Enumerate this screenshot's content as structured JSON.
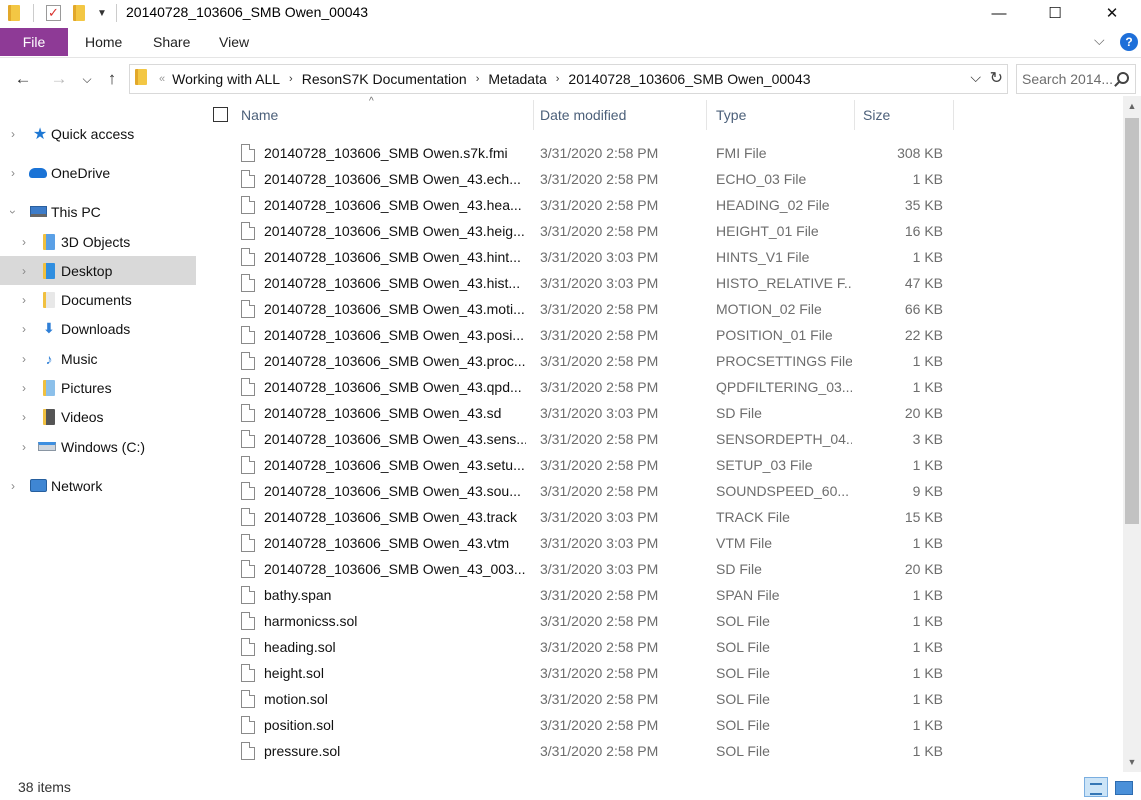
{
  "window": {
    "title": "20140728_103606_SMB Owen_00043",
    "controls": {
      "minimize": "—",
      "maximize": "☐",
      "close": "✕"
    }
  },
  "ribbon": {
    "file_tab": "File",
    "tabs": [
      "Home",
      "Share",
      "View"
    ],
    "accent": "#8e3a96",
    "help": "?"
  },
  "address": {
    "breadcrumbs": [
      "Working with ALL",
      "ResonS7K Documentation",
      "Metadata",
      "20140728_103606_SMB Owen_00043"
    ],
    "overflow": "«",
    "search_placeholder": "Search 2014..."
  },
  "navigation": {
    "items": [
      {
        "label": "Quick access",
        "icon": "star-icon"
      },
      {
        "label": "OneDrive",
        "icon": "cloud-icon"
      },
      {
        "label": "This PC",
        "icon": "computer-icon"
      },
      {
        "label": "3D Objects",
        "icon": "cube-folder-icon"
      },
      {
        "label": "Desktop",
        "icon": "desktop-folder-icon"
      },
      {
        "label": "Documents",
        "icon": "documents-folder-icon"
      },
      {
        "label": "Downloads",
        "icon": "downloads-folder-icon"
      },
      {
        "label": "Music",
        "icon": "music-folder-icon"
      },
      {
        "label": "Pictures",
        "icon": "pictures-folder-icon"
      },
      {
        "label": "Videos",
        "icon": "videos-folder-icon"
      },
      {
        "label": "Windows (C:)",
        "icon": "drive-icon"
      },
      {
        "label": "Network",
        "icon": "network-icon"
      }
    ]
  },
  "columns": {
    "name": "Name",
    "date": "Date modified",
    "type": "Type",
    "size": "Size"
  },
  "files": [
    {
      "name": "20140728_103606_SMB Owen.s7k.fmi",
      "date": "3/31/2020 2:58 PM",
      "type": "FMI File",
      "size": "308 KB"
    },
    {
      "name": "20140728_103606_SMB Owen_43.ech...",
      "date": "3/31/2020 2:58 PM",
      "type": "ECHO_03 File",
      "size": "1 KB"
    },
    {
      "name": "20140728_103606_SMB Owen_43.hea...",
      "date": "3/31/2020 2:58 PM",
      "type": "HEADING_02 File",
      "size": "35 KB"
    },
    {
      "name": "20140728_103606_SMB Owen_43.heig...",
      "date": "3/31/2020 2:58 PM",
      "type": "HEIGHT_01 File",
      "size": "16 KB"
    },
    {
      "name": "20140728_103606_SMB Owen_43.hint...",
      "date": "3/31/2020 3:03 PM",
      "type": "HINTS_V1 File",
      "size": "1 KB"
    },
    {
      "name": "20140728_103606_SMB Owen_43.hist...",
      "date": "3/31/2020 3:03 PM",
      "type": "HISTO_RELATIVE F...",
      "size": "47 KB"
    },
    {
      "name": "20140728_103606_SMB Owen_43.moti...",
      "date": "3/31/2020 2:58 PM",
      "type": "MOTION_02 File",
      "size": "66 KB"
    },
    {
      "name": "20140728_103606_SMB Owen_43.posi...",
      "date": "3/31/2020 2:58 PM",
      "type": "POSITION_01 File",
      "size": "22 KB"
    },
    {
      "name": "20140728_103606_SMB Owen_43.proc...",
      "date": "3/31/2020 2:58 PM",
      "type": "PROCSETTINGS File",
      "size": "1 KB"
    },
    {
      "name": "20140728_103606_SMB Owen_43.qpd...",
      "date": "3/31/2020 2:58 PM",
      "type": "QPDFILTERING_03...",
      "size": "1 KB"
    },
    {
      "name": "20140728_103606_SMB Owen_43.sd",
      "date": "3/31/2020 3:03 PM",
      "type": "SD File",
      "size": "20 KB"
    },
    {
      "name": "20140728_103606_SMB Owen_43.sens...",
      "date": "3/31/2020 2:58 PM",
      "type": "SENSORDEPTH_04...",
      "size": "3 KB"
    },
    {
      "name": "20140728_103606_SMB Owen_43.setu...",
      "date": "3/31/2020 2:58 PM",
      "type": "SETUP_03 File",
      "size": "1 KB"
    },
    {
      "name": "20140728_103606_SMB Owen_43.sou...",
      "date": "3/31/2020 2:58 PM",
      "type": "SOUNDSPEED_60...",
      "size": "9 KB"
    },
    {
      "name": "20140728_103606_SMB Owen_43.track",
      "date": "3/31/2020 3:03 PM",
      "type": "TRACK File",
      "size": "15 KB"
    },
    {
      "name": "20140728_103606_SMB Owen_43.vtm",
      "date": "3/31/2020 3:03 PM",
      "type": "VTM File",
      "size": "1 KB"
    },
    {
      "name": "20140728_103606_SMB Owen_43_003....",
      "date": "3/31/2020 3:03 PM",
      "type": "SD File",
      "size": "20 KB"
    },
    {
      "name": "bathy.span",
      "date": "3/31/2020 2:58 PM",
      "type": "SPAN File",
      "size": "1 KB"
    },
    {
      "name": "harmonicss.sol",
      "date": "3/31/2020 2:58 PM",
      "type": "SOL File",
      "size": "1 KB"
    },
    {
      "name": "heading.sol",
      "date": "3/31/2020 2:58 PM",
      "type": "SOL File",
      "size": "1 KB"
    },
    {
      "name": "height.sol",
      "date": "3/31/2020 2:58 PM",
      "type": "SOL File",
      "size": "1 KB"
    },
    {
      "name": "motion.sol",
      "date": "3/31/2020 2:58 PM",
      "type": "SOL File",
      "size": "1 KB"
    },
    {
      "name": "position.sol",
      "date": "3/31/2020 2:58 PM",
      "type": "SOL File",
      "size": "1 KB"
    },
    {
      "name": "pressure.sol",
      "date": "3/31/2020 2:58 PM",
      "type": "SOL File",
      "size": "1 KB"
    }
  ],
  "status": {
    "item_count": "38 items"
  }
}
